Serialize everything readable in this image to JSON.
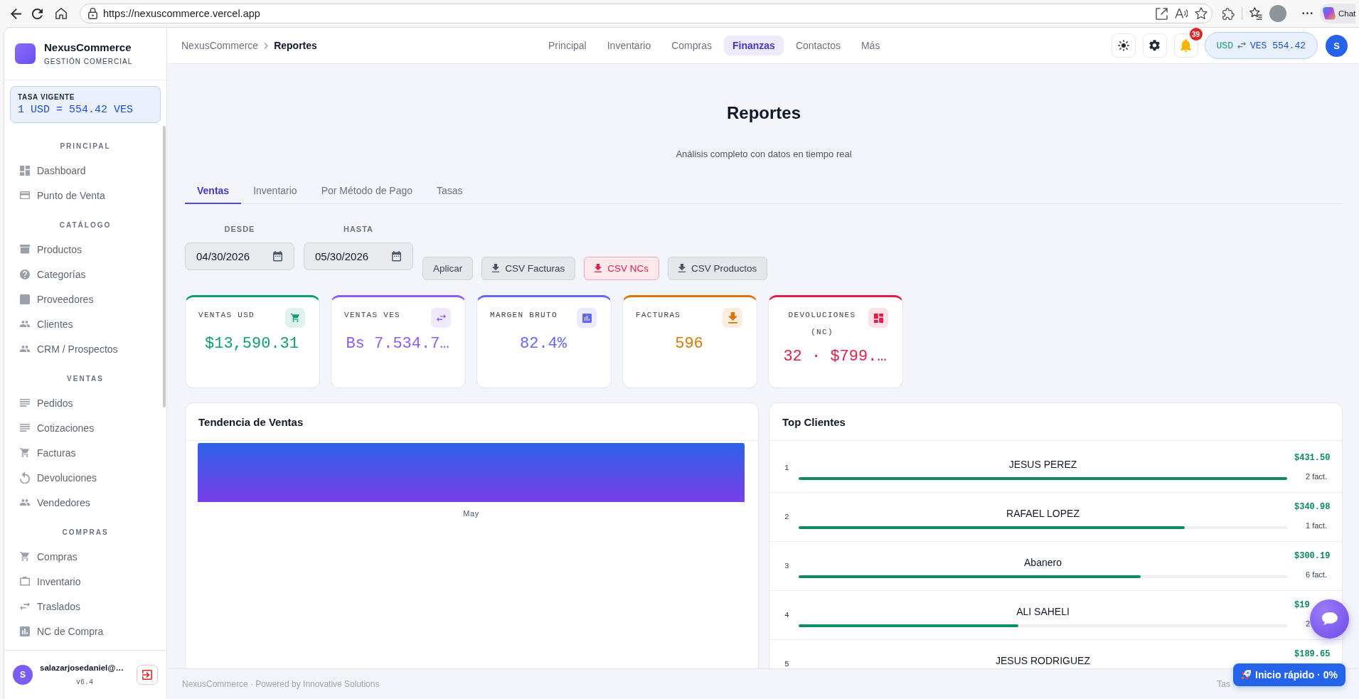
{
  "browser": {
    "url": "https://nexuscommerce.vercel.app",
    "chat_label": "Chat"
  },
  "sidebar": {
    "brand": {
      "name": "NexusCommerce",
      "tagline": "GESTIÓN COMERCIAL"
    },
    "rate_card": {
      "label": "TASA VIGENTE",
      "value": "1 USD = 554.42 VES"
    },
    "sections": [
      {
        "title": "PRINCIPAL",
        "items": [
          {
            "label": "Dashboard",
            "selected": false
          },
          {
            "label": "Punto de Venta",
            "selected": false
          }
        ]
      },
      {
        "title": "CATÁLOGO",
        "items": [
          {
            "label": "Productos",
            "selected": false
          },
          {
            "label": "Categorías",
            "selected": false
          },
          {
            "label": "Proveedores",
            "selected": false
          },
          {
            "label": "Clientes",
            "selected": false
          },
          {
            "label": "CRM / Prospectos",
            "selected": false
          }
        ]
      },
      {
        "title": "VENTAS",
        "items": [
          {
            "label": "Pedidos",
            "selected": false
          },
          {
            "label": "Cotizaciones",
            "selected": false
          },
          {
            "label": "Facturas",
            "selected": false
          },
          {
            "label": "Devoluciones",
            "selected": false
          },
          {
            "label": "Vendedores",
            "selected": false
          }
        ]
      },
      {
        "title": "COMPRAS",
        "items": [
          {
            "label": "Compras",
            "selected": false
          },
          {
            "label": "Inventario",
            "selected": false
          },
          {
            "label": "Traslados",
            "selected": false
          },
          {
            "label": "NC de Compra",
            "selected": false
          }
        ]
      }
    ],
    "user": {
      "initial": "S",
      "email": "salazarjosedaniel@…",
      "version": "v6.4"
    }
  },
  "header": {
    "breadcrumb": [
      "NexusCommerce",
      "Reportes"
    ],
    "nav": [
      {
        "label": "Principal",
        "selected": false
      },
      {
        "label": "Inventario",
        "selected": false
      },
      {
        "label": "Compras",
        "selected": false
      },
      {
        "label": "Finanzas",
        "selected": true
      },
      {
        "label": "Contactos",
        "selected": false
      },
      {
        "label": "Más",
        "selected": false
      }
    ],
    "notifications": "39",
    "rate": {
      "from": "USD",
      "to": "VES 554.42"
    },
    "user_initial": "S"
  },
  "report": {
    "title": "Reportes",
    "subtitle": "Análisis completo con datos en tiempo real",
    "tabs": [
      {
        "label": "Ventas",
        "selected": true
      },
      {
        "label": "Inventario",
        "selected": false
      },
      {
        "label": "Por Método de Pago",
        "selected": false
      },
      {
        "label": "Tasas",
        "selected": false
      }
    ],
    "date_filters": [
      {
        "label": "DESDE",
        "value": "04/30/2026"
      },
      {
        "label": "HASTA",
        "value": "05/30/2026"
      }
    ],
    "actions": [
      {
        "label": "Aplicar",
        "kind": "plain"
      },
      {
        "label": "CSV Facturas",
        "kind": "export"
      },
      {
        "label": "CSV NCs",
        "kind": "alert"
      },
      {
        "label": "CSV Productos",
        "kind": "export"
      }
    ],
    "stats": [
      {
        "label": "VENTAS USD",
        "value": "$13,590.31",
        "color": "#0e9f6e"
      },
      {
        "label": "VENTAS VES",
        "value": "Bs 7.534.7…",
        "color": "#8b5cf6"
      },
      {
        "label": "MARGEN BRUTO",
        "value": "82.4%",
        "color": "#6366f1"
      },
      {
        "label": "FACTURAS",
        "value": "596",
        "color": "#d97706"
      },
      {
        "label": "DEVOLUCIONES (NC)",
        "value": "32 · $799.…",
        "color": "#e11d48"
      }
    ],
    "trend": {
      "title": "Tendencia de Ventas",
      "x_labels": [
        "May"
      ]
    },
    "top_clients": {
      "title": "Top Clientes",
      "rows": [
        {
          "rank": "1",
          "name": "JESUS PEREZ",
          "amount": "$431.50",
          "invoices": "2 fact.",
          "level": 1.0
        },
        {
          "rank": "2",
          "name": "RAFAEL LOPEZ",
          "amount": "$340.98",
          "invoices": "1 fact.",
          "level": 0.79
        },
        {
          "rank": "3",
          "name": "Abanero",
          "amount": "$300.19",
          "invoices": "6 fact.",
          "level": 0.7
        },
        {
          "rank": "4",
          "name": "ALI SAHELI",
          "amount": "$19",
          "invoices": "2",
          "level": 0.45
        },
        {
          "rank": "5",
          "name": "JESUS RODRIGUEZ",
          "amount": "$189.65"
        }
      ]
    }
  },
  "footer": {
    "text": "NexusCommerce · Powered by Innovative Solutions",
    "right_text": "Tas"
  },
  "floating": {
    "quick_start": "Inicio rápido · 0%"
  }
}
